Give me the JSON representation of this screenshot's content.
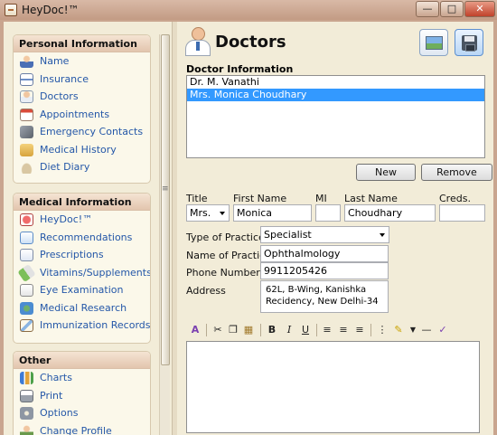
{
  "window": {
    "title": "HeyDoc!™",
    "min_label": "—",
    "max_label": "□",
    "close_label": "✕"
  },
  "sidebar": {
    "groups": [
      {
        "title": "Personal Information",
        "items": [
          {
            "label": "Name",
            "icon": "person-icon"
          },
          {
            "label": "Insurance",
            "icon": "insurance-card-icon"
          },
          {
            "label": "Doctors",
            "icon": "doctor-icon"
          },
          {
            "label": "Appointments",
            "icon": "calendar-icon"
          },
          {
            "label": "Emergency Contacts",
            "icon": "phone-icon"
          },
          {
            "label": "Medical History",
            "icon": "folder-icon"
          },
          {
            "label": "Diet Diary",
            "icon": "bowl-icon"
          }
        ]
      },
      {
        "title": "Medical Information",
        "items": [
          {
            "label": "HeyDoc!™",
            "icon": "heart-icon"
          },
          {
            "label": "Recommendations",
            "icon": "recommendation-icon"
          },
          {
            "label": "Prescriptions",
            "icon": "prescription-icon"
          },
          {
            "label": "Vitamins/Supplements",
            "icon": "pill-icon"
          },
          {
            "label": "Eye Examination",
            "icon": "eye-chart-icon"
          },
          {
            "label": "Medical Research",
            "icon": "globe-icon"
          },
          {
            "label": "Immunization Records",
            "icon": "syringe-icon"
          }
        ]
      },
      {
        "title": "Other",
        "items": [
          {
            "label": "Charts",
            "icon": "chart-icon"
          },
          {
            "label": "Print",
            "icon": "print-icon"
          },
          {
            "label": "Options",
            "icon": "gear-icon"
          },
          {
            "label": "Change Profile",
            "icon": "user-icon"
          }
        ]
      }
    ]
  },
  "main": {
    "title": "Doctors",
    "section_label": "Doctor Information",
    "doctors": [
      "Dr. M. Vanathi",
      "Mrs. Monica Choudhary"
    ],
    "selected_index": 1,
    "buttons": {
      "new": "New",
      "remove": "Remove"
    },
    "form": {
      "title_label": "Title",
      "first_name_label": "First Name",
      "mi_label": "MI",
      "last_name_label": "Last Name",
      "creds_label": "Creds.",
      "title_value": "Mrs.",
      "first_name_value": "Monica",
      "mi_value": "",
      "last_name_value": "Choudhary",
      "creds_value": "",
      "type_label": "Type of Practice",
      "type_value": "Specialist",
      "practice_name_label": "Name of Practice",
      "practice_name_value": "Ophthalmology",
      "phone_label": "Phone Number",
      "phone_value": "9911205426",
      "address_label": "Address",
      "address_line1": "62L, B-Wing, Kanishka",
      "address_line2": "Recidency, New Delhi-34"
    },
    "toolbar": {
      "bold": "B",
      "italic": "I",
      "underline": "U"
    }
  }
}
